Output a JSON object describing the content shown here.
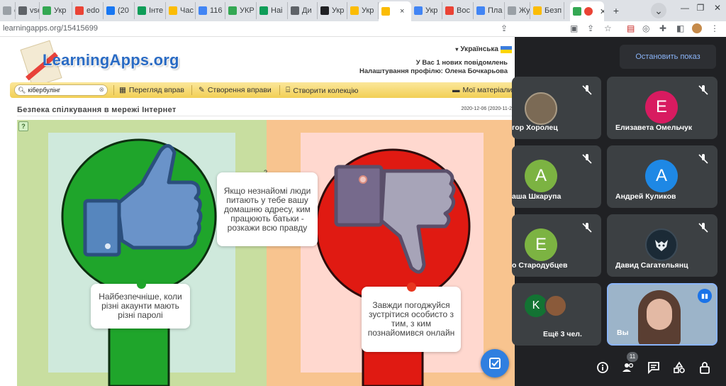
{
  "browser": {
    "tabs": [
      {
        "label": "c",
        "color": "#9aa0a6"
      },
      {
        "label": "vse",
        "color": "#5f6368"
      },
      {
        "label": "Укр",
        "color": "#34a853"
      },
      {
        "label": "edo",
        "color": "#ea4335"
      },
      {
        "label": "(20",
        "color": "#1877f2"
      },
      {
        "label": "Інте",
        "color": "#0f9d58"
      },
      {
        "label": "Час",
        "color": "#fbbc04"
      },
      {
        "label": "116",
        "color": "#4285f4"
      },
      {
        "label": "УКР",
        "color": "#34a853"
      },
      {
        "label": "Наі",
        "color": "#0f9d58"
      },
      {
        "label": "Ди",
        "color": "#5f6368"
      },
      {
        "label": "Укр",
        "color": "#202124"
      },
      {
        "label": "Укр",
        "color": "#fbbc04"
      },
      {
        "label": "",
        "color": "#fbbc04"
      },
      {
        "label": "Укр",
        "color": "#4285f4"
      },
      {
        "label": "Boc",
        "color": "#ea4335"
      },
      {
        "label": "Пла",
        "color": "#4285f4"
      },
      {
        "label": "Жур",
        "color": "#9aa0a6"
      },
      {
        "label": "Безп",
        "color": "#fbbc04"
      }
    ],
    "active_tab_close": "×",
    "new_tab": "+",
    "url": "learningapps.org/15415699"
  },
  "page": {
    "logo_text": "LearningApps.org",
    "language": "Українська",
    "messages": "У Вас 1 нових повідомлень",
    "profile": "Налаштування профілю: Олена Бочкарьова",
    "search_value": "кібербулінг",
    "nav": {
      "browse": "Перегляд вправ",
      "create": "Створення вправи",
      "collection": "Створити колекцію",
      "materials": "Мої матеріали"
    },
    "title": "Безпека спілкування в мережі Інтернет",
    "date": "2020-12-06",
    "date_small": "(2020-11-2"
  },
  "exercise": {
    "question_mark": "?",
    "center_card": "Якщо незнайомі люди питають у тебе вашу домашню адресу, ким працюють батьки - розкажи всю правду",
    "left_card": "Найбезпечніше, коли різні акаунти мають різні паролі",
    "right_card": "Завжди погоджуйся зустрітися особисто з тим, з ким познайомився онлайн",
    "left_color": "#1fa52b",
    "right_color": "#e01a12"
  },
  "meet": {
    "stop_label": "Остановить показ",
    "participants": [
      {
        "name": "гор Хоролец",
        "initial": "",
        "color": "#7b6a55"
      },
      {
        "name": "Елизавета Омельчук",
        "initial": "Е",
        "color": "#d81b60"
      },
      {
        "name": "аша Шкарупа",
        "initial": "А",
        "color": "#7cb342"
      },
      {
        "name": "Андрей Куликов",
        "initial": "А",
        "color": "#1e88e5"
      },
      {
        "name": "о Стародубцев",
        "initial": "Е",
        "color": "#7cb342"
      },
      {
        "name": "Давид Сагательянц",
        "initial": "",
        "color": "#1b2a36"
      },
      {
        "name": "Ещё 3 чел.",
        "initial": "K",
        "color": "#137333"
      },
      {
        "name": "Вы",
        "initial": "",
        "color": "#6b8aa3"
      }
    ],
    "people_count": "11"
  }
}
